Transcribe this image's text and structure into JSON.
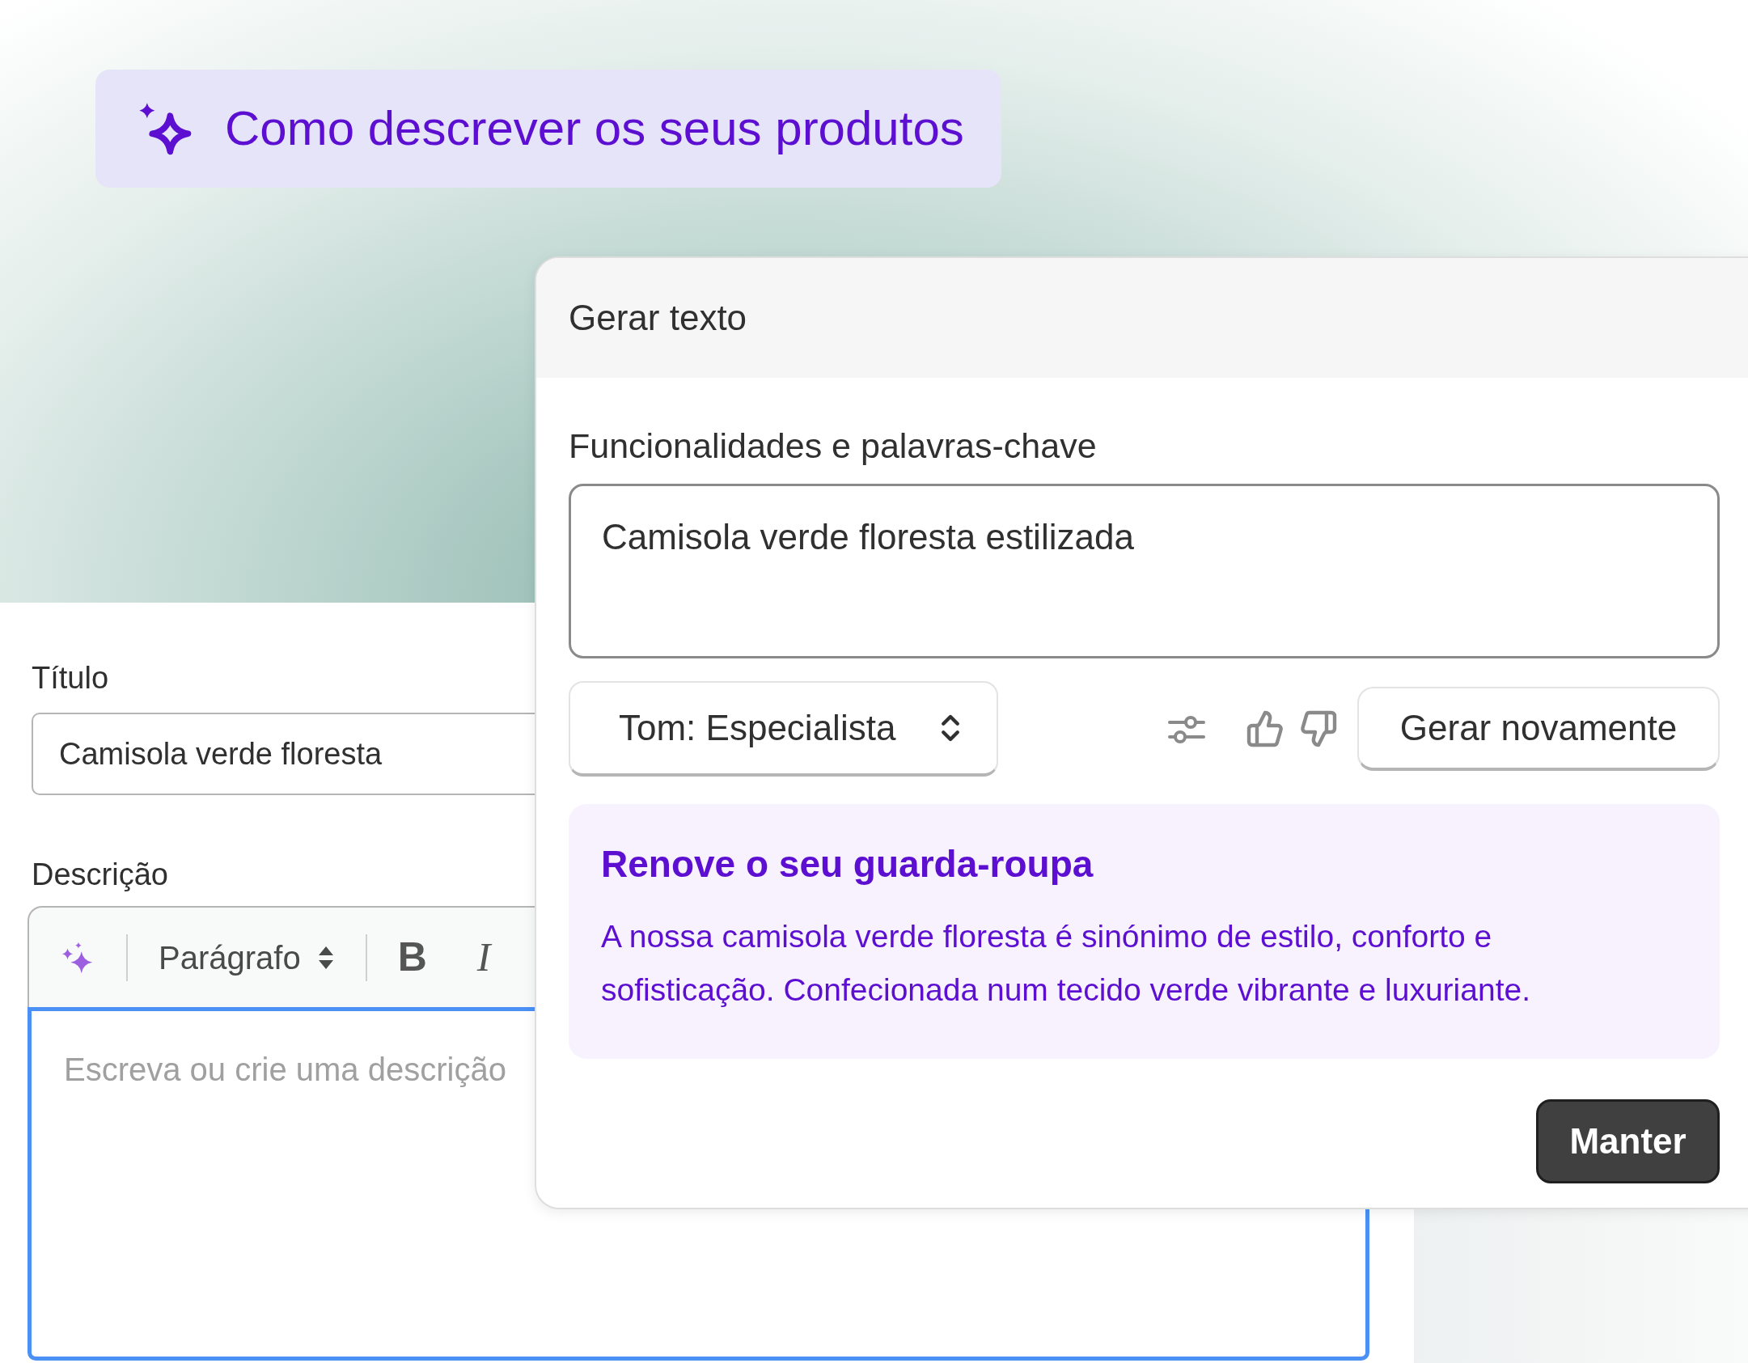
{
  "banner": {
    "title": "Como descrever os seus produtos"
  },
  "form": {
    "title_label": "Título",
    "title_value": "Camisola verde floresta",
    "description_label": "Descrição",
    "format_select": "Parágrafo",
    "bold_key": "B",
    "italic_key": "I",
    "description_placeholder": "Escreva ou crie uma descrição"
  },
  "dialog": {
    "title": "Gerar texto",
    "keywords_label": "Funcionalidades e palavras-chave",
    "keywords_value": "Camisola verde floresta estilizada",
    "tone_select": "Tom: Especialista",
    "regenerate_button": "Gerar novamente",
    "result": {
      "heading": "Renove o seu guarda-roupa",
      "body": "A nossa camisola verde floresta é sinónimo de estilo, conforto e sofisticação. Confecionada num tecido verde vibrante e luxuriante."
    },
    "keep_button": "Manter"
  }
}
